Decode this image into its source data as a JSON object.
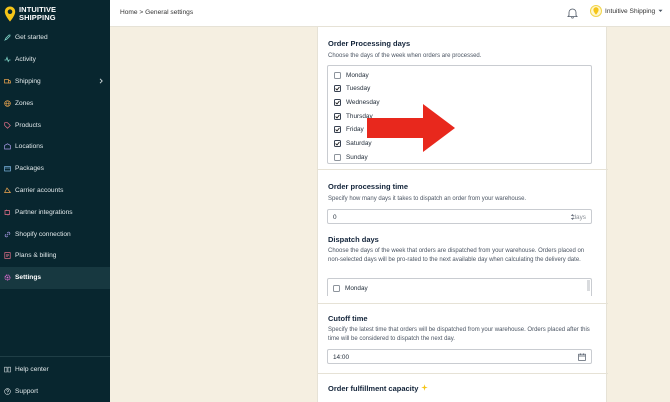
{
  "app": {
    "logo_line1": "INTUITIVE",
    "logo_line2": "SHIPPING"
  },
  "sidebar": {
    "items": [
      {
        "label": "Get started",
        "icon": "rocket-icon"
      },
      {
        "label": "Activity",
        "icon": "activity-icon"
      },
      {
        "label": "Shipping",
        "icon": "truck-icon",
        "has_submenu": true
      },
      {
        "label": "Zones",
        "icon": "globe-icon"
      },
      {
        "label": "Products",
        "icon": "tag-icon"
      },
      {
        "label": "Locations",
        "icon": "warehouse-icon"
      },
      {
        "label": "Packages",
        "icon": "package-icon"
      },
      {
        "label": "Carrier accounts",
        "icon": "carrier-icon"
      },
      {
        "label": "Partner integrations",
        "icon": "puzzle-icon"
      },
      {
        "label": "Shopify connection",
        "icon": "link-icon"
      },
      {
        "label": "Plans & billing",
        "icon": "billing-icon"
      },
      {
        "label": "Settings",
        "icon": "gear-icon",
        "active": true
      }
    ],
    "bottom": [
      {
        "label": "Help center",
        "icon": "book-icon"
      },
      {
        "label": "Support",
        "icon": "question-icon"
      }
    ]
  },
  "header": {
    "breadcrumb": "Home > General settings",
    "user_label": "Intuitive Shipping"
  },
  "sections": {
    "processing_days": {
      "title": "Order Processing days",
      "description": "Choose the days of the week when orders are processed.",
      "days": [
        {
          "label": "Monday",
          "checked": false
        },
        {
          "label": "Tuesday",
          "checked": true
        },
        {
          "label": "Wednesday",
          "checked": true
        },
        {
          "label": "Thursday",
          "checked": true
        },
        {
          "label": "Friday",
          "checked": true
        },
        {
          "label": "Saturday",
          "checked": true
        },
        {
          "label": "Sunday",
          "checked": false
        }
      ]
    },
    "processing_time": {
      "title": "Order processing time",
      "description": "Specify how many days it takes to dispatch an order from your warehouse.",
      "value": "0",
      "suffix": "days"
    },
    "dispatch_days": {
      "title": "Dispatch days",
      "description": "Choose the days of the week that orders are dispatched from your warehouse. Orders placed on non-selected days will be pro-rated to the next available day when calculating the delivery date.",
      "first_day": "Monday"
    },
    "cutoff_time": {
      "title": "Cutoff time",
      "description": "Specify the latest time that orders will be dispatched from your warehouse. Orders placed after this time will be considered to dispatch the next day.",
      "value": "14:00"
    },
    "fulfillment_capacity": {
      "title": "Order fulfillment capacity"
    }
  },
  "colors": {
    "sidebar_bg": "#08262f",
    "page_bg": "#f5efe1",
    "arrow": "#e8281d",
    "logo_yellow": "#f5c518"
  }
}
